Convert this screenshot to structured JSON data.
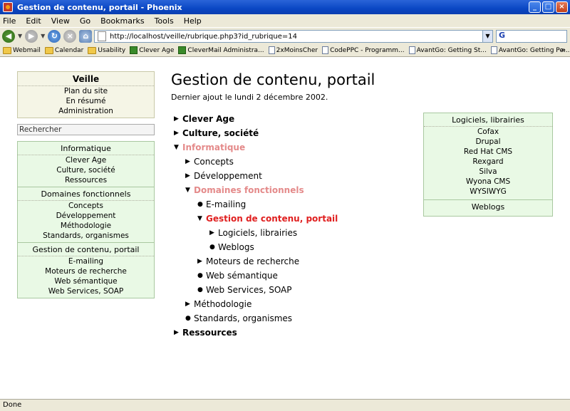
{
  "window": {
    "title": "Gestion de contenu, portail - Phoenix"
  },
  "menu": [
    "File",
    "Edit",
    "View",
    "Go",
    "Bookmarks",
    "Tools",
    "Help"
  ],
  "nav": {
    "url": "http://localhost/veille/rubrique.php3?id_rubrique=14",
    "search_glyph": "G"
  },
  "bookmarks": [
    {
      "label": "Webmail",
      "icon": "folder"
    },
    {
      "label": "Calendar",
      "icon": "folder"
    },
    {
      "label": "Usability",
      "icon": "folder"
    },
    {
      "label": "Clever Age",
      "icon": "favicon"
    },
    {
      "label": "CleverMail Administra...",
      "icon": "favicon"
    },
    {
      "label": "2xMoinsCher",
      "icon": "page"
    },
    {
      "label": "CodePPC - Programm...",
      "icon": "page"
    },
    {
      "label": "AvantGo: Getting St...",
      "icon": "page"
    },
    {
      "label": "AvantGo: Getting Pe...",
      "icon": "page"
    }
  ],
  "bookmarks_more": "»",
  "left": {
    "veille": {
      "title": "Veille",
      "items": [
        "Plan du site",
        "En résumé",
        "Administration"
      ]
    },
    "search_label": "Rechercher",
    "groups": [
      {
        "title": "Informatique",
        "items": [
          "Clever Age",
          "Culture, société",
          "Ressources"
        ]
      },
      {
        "title": "Domaines fonctionnels",
        "items": [
          "Concepts",
          "Développement",
          "Méthodologie",
          "Standards, organismes"
        ]
      },
      {
        "title": "Gestion de contenu, portail",
        "items": [
          "E-mailing",
          "Moteurs de recherche",
          "Web sémantique",
          "Web Services, SOAP"
        ]
      }
    ]
  },
  "main": {
    "title": "Gestion de contenu, portail",
    "subtitle": "Dernier ajout le lundi 2 décembre 2002.",
    "tree": [
      {
        "label": "Clever Age",
        "level": 0,
        "marker": "▶",
        "style": "b"
      },
      {
        "label": "Culture, société",
        "level": 0,
        "marker": "▶",
        "style": "b"
      },
      {
        "label": "Informatique",
        "level": 0,
        "marker": "▼",
        "style": "pink"
      },
      {
        "label": "Concepts",
        "level": 1,
        "marker": "▶",
        "style": ""
      },
      {
        "label": "Développement",
        "level": 1,
        "marker": "▶",
        "style": ""
      },
      {
        "label": "Domaines fonctionnels",
        "level": 1,
        "marker": "▼",
        "style": "pink"
      },
      {
        "label": "E-mailing",
        "level": 2,
        "marker": "●",
        "style": ""
      },
      {
        "label": "Gestion de contenu, portail",
        "level": 2,
        "marker": "▼",
        "style": "red"
      },
      {
        "label": "Logiciels, librairies",
        "level": 3,
        "marker": "▶",
        "style": ""
      },
      {
        "label": "Weblogs",
        "level": 3,
        "marker": "●",
        "style": ""
      },
      {
        "label": "Moteurs de recherche",
        "level": 2,
        "marker": "▶",
        "style": ""
      },
      {
        "label": "Web sémantique",
        "level": 2,
        "marker": "●",
        "style": ""
      },
      {
        "label": "Web Services, SOAP",
        "level": 2,
        "marker": "●",
        "style": ""
      },
      {
        "label": "Méthodologie",
        "level": 1,
        "marker": "▶",
        "style": ""
      },
      {
        "label": "Standards, organismes",
        "level": 1,
        "marker": "●",
        "style": ""
      },
      {
        "label": "Ressources",
        "level": 0,
        "marker": "▶",
        "style": "b"
      }
    ]
  },
  "right": {
    "groups": [
      {
        "title": "Logiciels, librairies",
        "items": [
          "Cofax",
          "Drupal",
          "Red Hat CMS",
          "Rexgard",
          "Silva",
          "Wyona CMS",
          "WYSIWYG"
        ]
      },
      {
        "title": "Weblogs",
        "items": []
      }
    ]
  },
  "status": "Done"
}
